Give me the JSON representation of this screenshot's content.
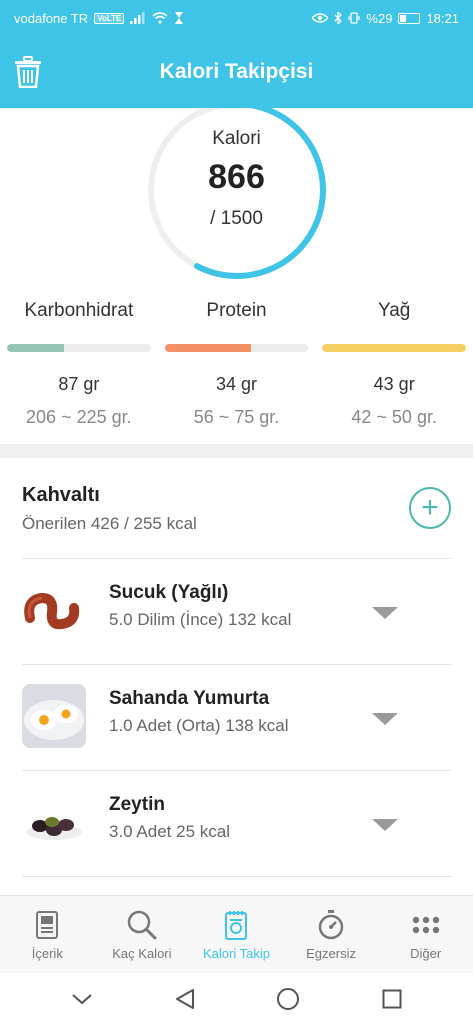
{
  "status_bar": {
    "carrier": "vodafone TR",
    "volte": "VoLTE",
    "battery": "%29",
    "time": "18:21"
  },
  "app_bar": {
    "title": "Kalori Takipçisi"
  },
  "calorie_ring": {
    "label": "Kalori",
    "consumed": "866",
    "target": "/ 1500",
    "progress": 0.577,
    "color": "#3ec4e6"
  },
  "macros": [
    {
      "name": "Karbonhidrat",
      "amount": "87 gr",
      "range": "206 ~ 225 gr.",
      "progress": 0.4,
      "color": "#94c4b4"
    },
    {
      "name": "Protein",
      "amount": "34 gr",
      "range": "56 ~ 75 gr.",
      "progress": 0.6,
      "color": "#f39068"
    },
    {
      "name": "Yağ",
      "amount": "43 gr",
      "range": "42 ~ 50 gr.",
      "progress": 1.0,
      "color": "#f6cf63"
    }
  ],
  "meal": {
    "title": "Kahvaltı",
    "subtitle": "Önerilen 426 / 255 kcal"
  },
  "foods": [
    {
      "name": "Sucuk (Yağlı)",
      "detail": "5.0 Dilim (İnce) 132 kcal"
    },
    {
      "name": "Sahanda Yumurta",
      "detail": "1.0 Adet (Orta) 138 kcal"
    },
    {
      "name": "Zeytin",
      "detail": "3.0 Adet 25 kcal"
    }
  ],
  "bottom_nav": [
    {
      "label": "İçerik",
      "icon": "document-icon"
    },
    {
      "label": "Kaç Kalori",
      "icon": "search-icon"
    },
    {
      "label": "Kalori Takip",
      "icon": "tracker-icon",
      "active": true
    },
    {
      "label": "Egzersiz",
      "icon": "stopwatch-icon"
    },
    {
      "label": "Diğer",
      "icon": "more-grid-icon"
    }
  ],
  "colors": {
    "accent": "#3ec4e6",
    "add_button": "#4ab8b0"
  }
}
